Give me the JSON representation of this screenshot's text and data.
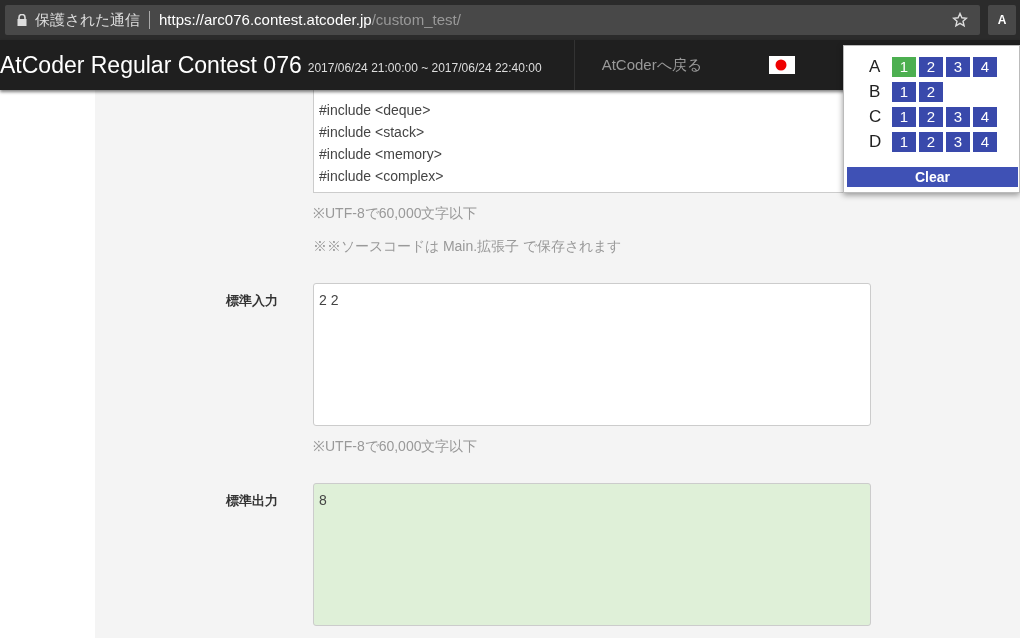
{
  "browser": {
    "security_label": "保護された通信",
    "url_host": "https://arc076.contest.atcoder.jp",
    "url_path": "/custom_test/",
    "extension_button": "A"
  },
  "navbar": {
    "title": "AtCoder Regular Contest 076",
    "period": "2017/06/24 21:00:00 ~ 2017/06/24 22:40:00",
    "back_link": "AtCoderへ戻る"
  },
  "popup": {
    "problems": [
      {
        "letter": "A",
        "cases": [
          {
            "label": "1",
            "done": true
          },
          {
            "label": "2",
            "done": false
          },
          {
            "label": "3",
            "done": false
          },
          {
            "label": "4",
            "done": false
          }
        ]
      },
      {
        "letter": "B",
        "cases": [
          {
            "label": "1",
            "done": false
          },
          {
            "label": "2",
            "done": false
          }
        ]
      },
      {
        "letter": "C",
        "cases": [
          {
            "label": "1",
            "done": false
          },
          {
            "label": "2",
            "done": false
          },
          {
            "label": "3",
            "done": false
          },
          {
            "label": "4",
            "done": false
          }
        ]
      },
      {
        "letter": "D",
        "cases": [
          {
            "label": "1",
            "done": false
          },
          {
            "label": "2",
            "done": false
          },
          {
            "label": "3",
            "done": false
          },
          {
            "label": "4",
            "done": false
          }
        ]
      }
    ],
    "clear_button": "Clear"
  },
  "source": {
    "lines": [
      "#include <deque>",
      "#include <stack>",
      "#include <memory>",
      "#include <complex>"
    ],
    "hints": [
      "※UTF-8で60,000文字以下",
      "※※ソースコードは Main.拡張子 で保存されます"
    ]
  },
  "stdin": {
    "label": "標準入力",
    "value": "2 2",
    "hint": "※UTF-8で60,000文字以下"
  },
  "stdout": {
    "label": "標準出力",
    "value": "8"
  }
}
